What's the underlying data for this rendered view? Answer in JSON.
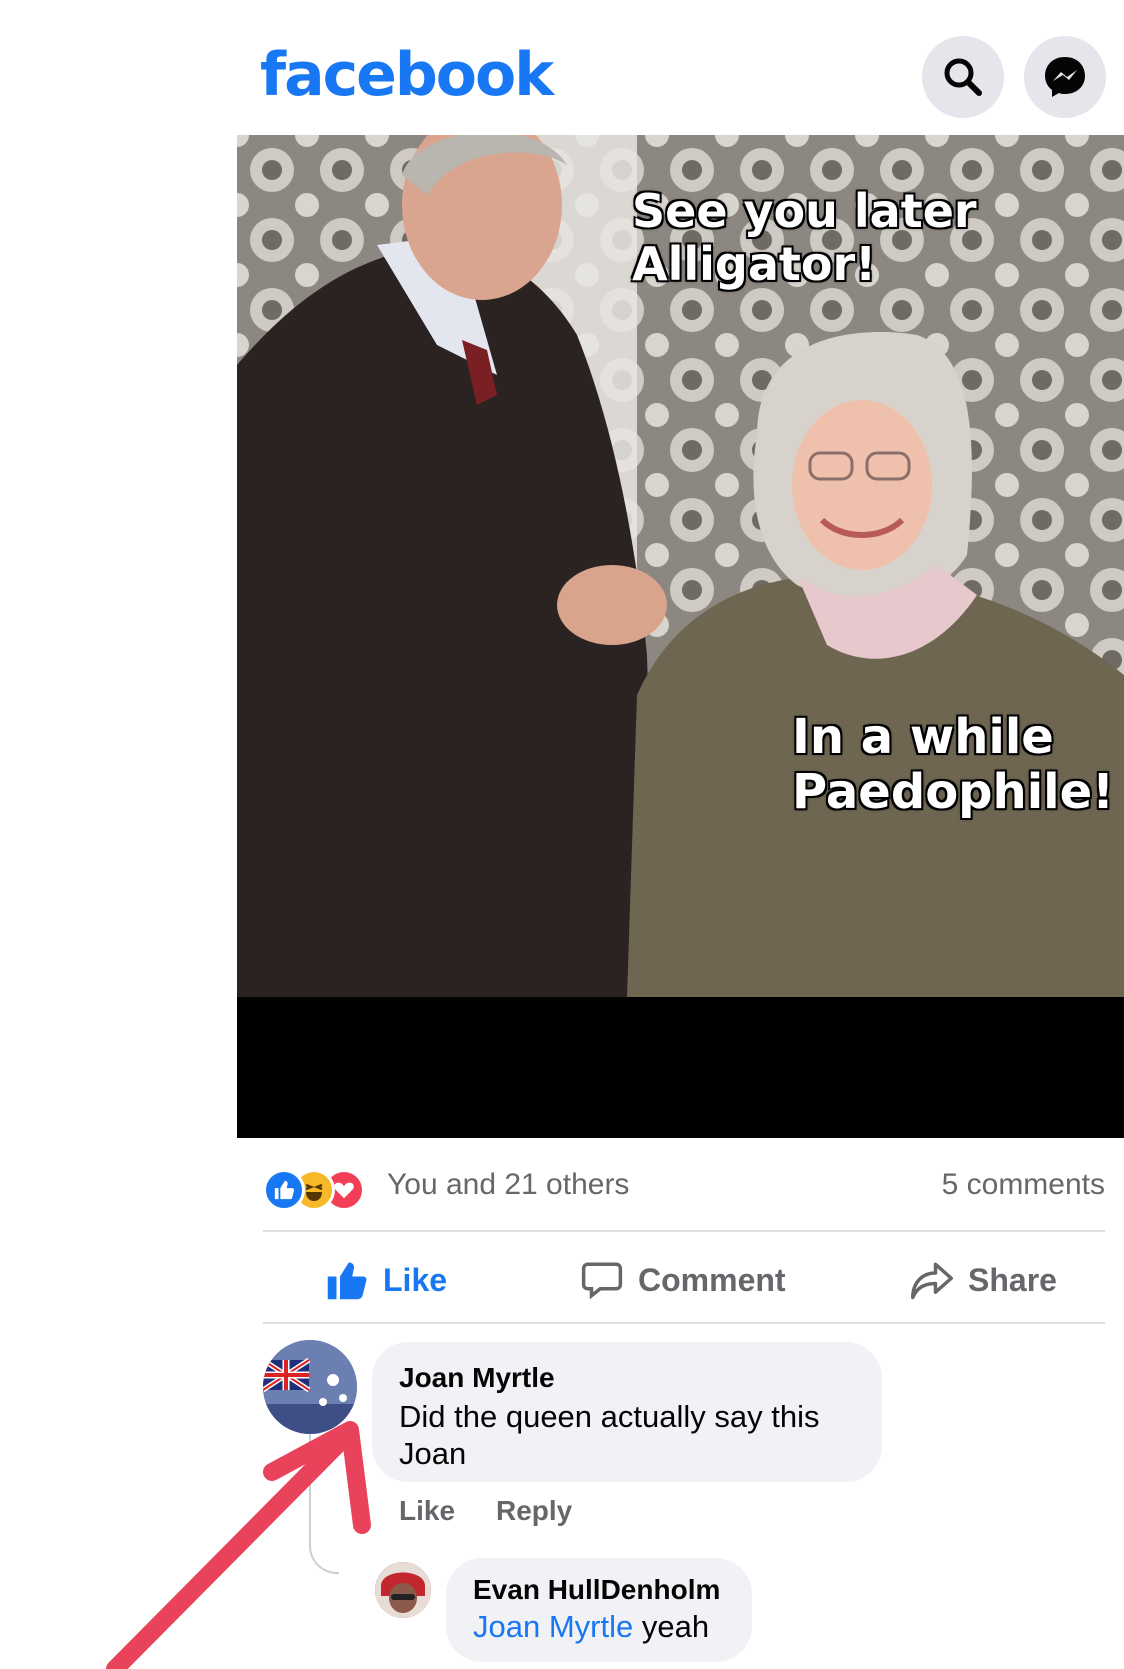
{
  "header": {
    "logo": "facebook",
    "buttons": [
      {
        "icon": "search-icon"
      },
      {
        "icon": "messenger-icon"
      }
    ]
  },
  "post": {
    "image": {
      "caption_top": [
        "See you later",
        "Alligator!"
      ],
      "caption_bottom": [
        "In a while",
        "Paedophile!"
      ]
    },
    "reactions": {
      "types": [
        "like",
        "haha",
        "love"
      ],
      "summary": "You and 21 others",
      "comments_count": "5 comments"
    },
    "actions": {
      "like": "Like",
      "comment": "Comment",
      "share": "Share"
    }
  },
  "comments": [
    {
      "author": "Joan Myrtle",
      "text": "Did the queen actually say this Joan",
      "actions": {
        "like": "Like",
        "reply": "Reply"
      }
    }
  ],
  "replies": [
    {
      "author": "Evan HullDenholm",
      "mention": "Joan Myrtle",
      "text": "yeah"
    }
  ],
  "colors": {
    "brand": "#1877f2",
    "like_active": "#1877f2",
    "secondary_text": "#65676b",
    "bubble": "#f0f2f5",
    "arrow_annotation": "#e8435a"
  }
}
